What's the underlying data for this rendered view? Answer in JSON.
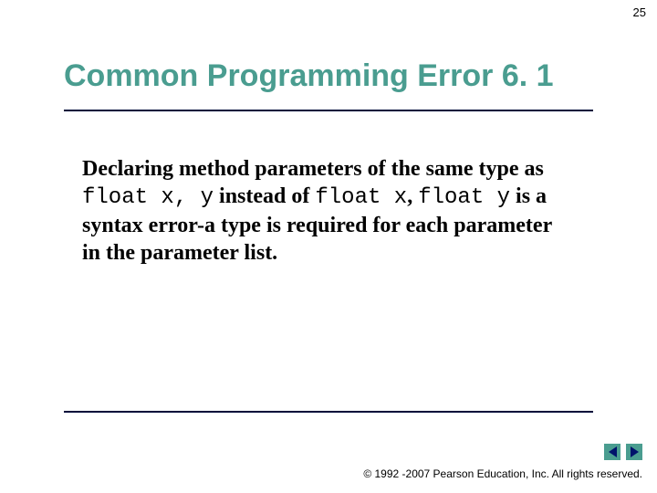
{
  "page_number": "25",
  "title": "Common Programming Error 6. 1",
  "body": {
    "p1": "Declaring method parameters of the same type as ",
    "c1": "float x, y",
    "p2": " instead of ",
    "c2": "float x",
    "p3": ", ",
    "c3": "float y",
    "p4": " is a syntax error-a type is required for each parameter in the parameter list."
  },
  "footer": "© 1992 -2007 Pearson Education, Inc.  All rights reserved."
}
